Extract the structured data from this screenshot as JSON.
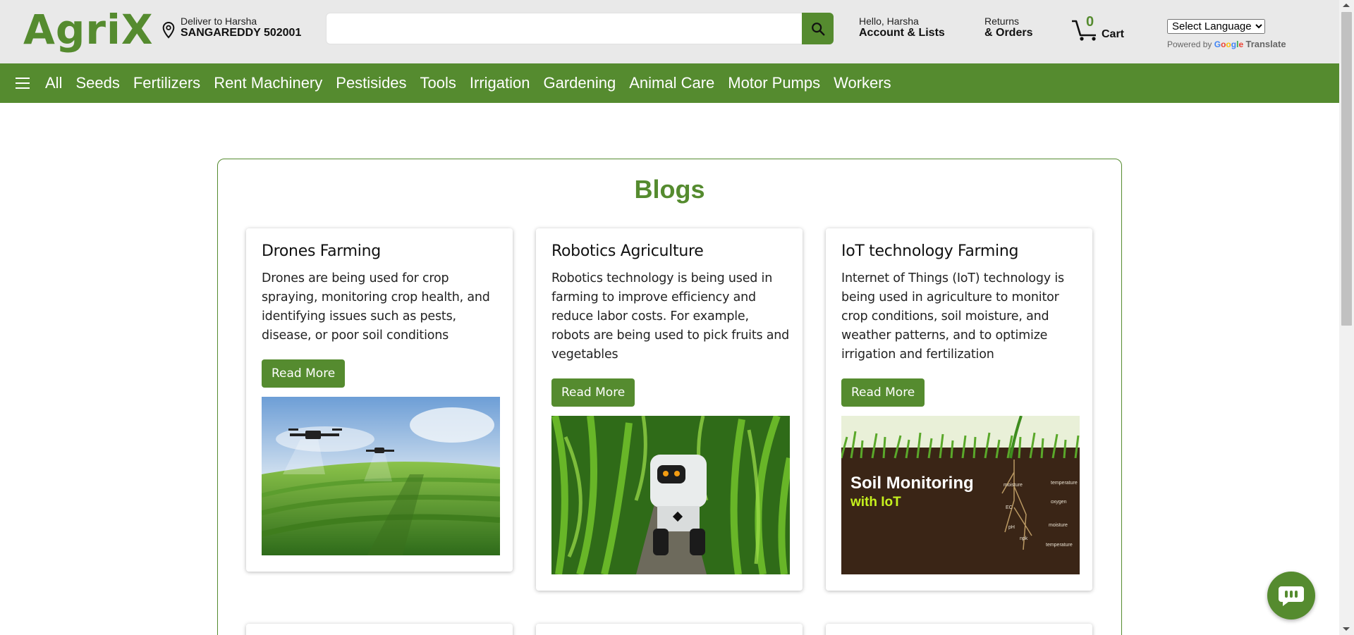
{
  "header": {
    "logo": "AgriX",
    "deliver_line1": "Deliver to Harsha",
    "deliver_line2": "SANGAREDDY 502001",
    "search_placeholder": "",
    "account_line1": "Hello, Harsha",
    "account_line2": "Account & Lists",
    "orders_line1": "Returns",
    "orders_line2": "& Orders",
    "cart_count": "0",
    "cart_label": "Cart",
    "language_selected": "Select Language",
    "powered_by": "Powered by",
    "google": "Google",
    "translate": "Translate"
  },
  "nav": {
    "items": [
      "All",
      "Seeds",
      "Fertilizers",
      "Rent Machinery",
      "Pestisides",
      "Tools",
      "Irrigation",
      "Gardening",
      "Animal Care",
      "Motor Pumps",
      "Workers"
    ]
  },
  "blogs": {
    "title": "Blogs",
    "cards": [
      {
        "title": "Drones Farming",
        "text": "Drones are being used for crop spraying, monitoring crop health, and identifying issues such as pests, disease, or poor soil conditions",
        "button": "Read More"
      },
      {
        "title": "Robotics Agriculture",
        "text": "Robotics technology is being used in farming to improve efficiency and reduce labor costs. For example, robots are being used to pick fruits and vegetables",
        "button": "Read More"
      },
      {
        "title": "IoT technology Farming",
        "text": "Internet of Things (IoT) technology is being used in agriculture to monitor crop conditions, soil moisture, and weather patterns, and to optimize irrigation and fertilization",
        "button": "Read More",
        "image_title": "Soil Monitoring",
        "image_subtitle": "with IoT",
        "image_labels": [
          "moisture",
          "temperature",
          "oxygen",
          "EC",
          "pH",
          "moisture",
          "npk",
          "temperature"
        ]
      }
    ]
  },
  "colors": {
    "brand": "#558b2f",
    "header_bg": "#e9e9e9"
  },
  "icons": {
    "location": "location-pin-icon",
    "search": "search-icon",
    "cart": "cart-icon",
    "menu": "hamburger-menu-icon",
    "chat": "chat-bot-icon"
  }
}
